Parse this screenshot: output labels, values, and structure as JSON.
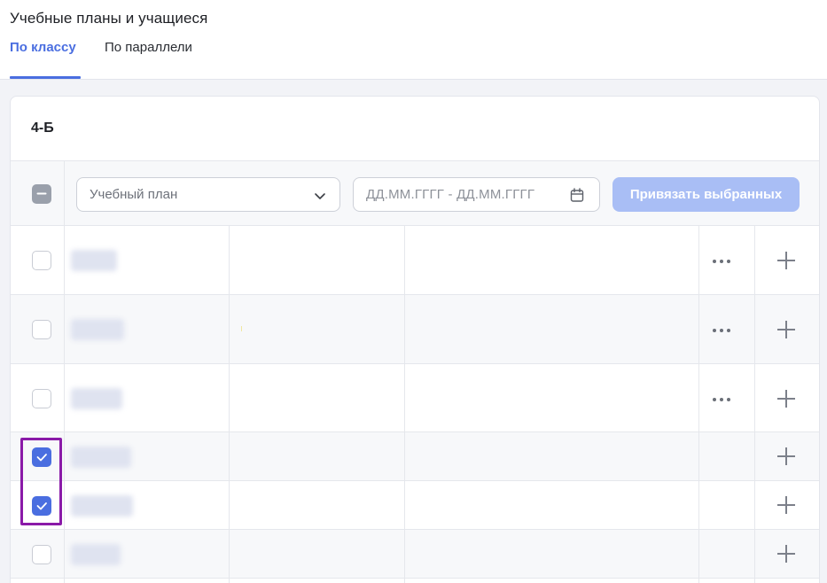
{
  "header": {
    "title": "Учебные планы и учащиеся",
    "tabs": [
      {
        "label": "По классу",
        "active": true
      },
      {
        "label": "По параллели",
        "active": false
      }
    ]
  },
  "card": {
    "class_name": "4-Б",
    "toolbar": {
      "select_all_state": "indeterminate",
      "plan_select": {
        "placeholder": "Учебный план",
        "icon": "chevron-down-icon"
      },
      "date_range": {
        "placeholder": "ДД.ММ.ГГГГ - ДД.ММ.ГГГГ",
        "icon": "calendar-icon"
      },
      "bind_button": "Привязать выбранных"
    },
    "rows": [
      {
        "checked": false,
        "name": "",
        "has_menu": true
      },
      {
        "checked": false,
        "name": "",
        "has_menu": true
      },
      {
        "checked": false,
        "name": "",
        "has_menu": true
      },
      {
        "checked": true,
        "name": "",
        "has_menu": false
      },
      {
        "checked": true,
        "name": "",
        "has_menu": false
      },
      {
        "checked": false,
        "name": "",
        "has_menu": false
      }
    ]
  },
  "colors": {
    "accent": "#4a6ee0",
    "button_disabled": "#a9bef5",
    "highlight": "#8a1aa8"
  }
}
